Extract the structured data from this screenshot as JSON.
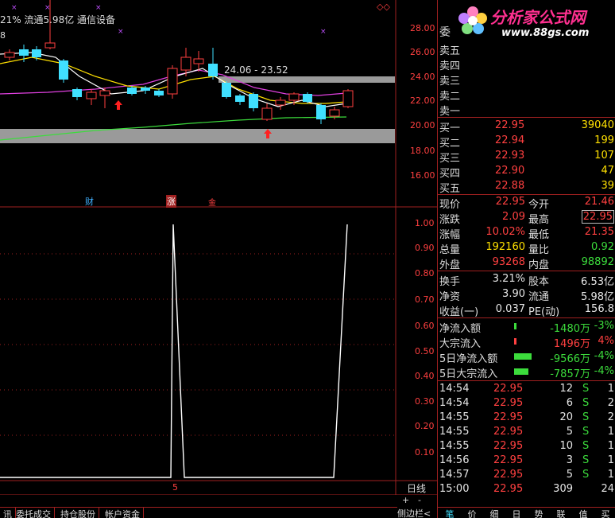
{
  "header": {
    "info_text": "21% 流通5.98亿 通信设备",
    "left_num": "8"
  },
  "logo": {
    "title": "分析家公式网",
    "url": "www.88gs.com"
  },
  "colors": {
    "up": "#ff4040",
    "down": "#40e0ff",
    "ma5": "#ffffff",
    "ma10": "#ffe000",
    "ma20": "#e040e0",
    "ma60": "#3cdc3c",
    "grid": "#a02020"
  },
  "kline": {
    "y_ticks": [
      "28.00",
      "26.00",
      "24.00",
      "22.00",
      "20.00",
      "18.00",
      "16.00"
    ],
    "range_label": "24.06 - 23.52",
    "markers": [
      "财",
      "涨",
      "金"
    ]
  },
  "indicator": {
    "y_ticks": [
      "1.00",
      "0.90",
      "0.80",
      "0.70",
      "0.60",
      "0.50",
      "0.40",
      "0.30",
      "0.20",
      "0.10"
    ],
    "bottom_label": "5",
    "period_label": "日线",
    "zoom_plus": "+",
    "zoom_minus": "-"
  },
  "chart_data": {
    "type": "line",
    "y_range": [
      0,
      1.05
    ],
    "points": [
      [
        0,
        0
      ],
      [
        215,
        0
      ],
      [
        218,
        1.0
      ],
      [
        232,
        0
      ],
      [
        420,
        0
      ],
      [
        437,
        1.0
      ]
    ]
  },
  "quote": {
    "wei": "委",
    "sell": [
      {
        "label": "卖五"
      },
      {
        "label": "卖四"
      },
      {
        "label": "卖三"
      },
      {
        "label": "卖二"
      },
      {
        "label": "卖一"
      }
    ],
    "buy": [
      {
        "label": "买一",
        "price": "22.95",
        "vol": "39040"
      },
      {
        "label": "买二",
        "price": "22.94",
        "vol": "199"
      },
      {
        "label": "买三",
        "price": "22.93",
        "vol": "107"
      },
      {
        "label": "买四",
        "price": "22.90",
        "vol": "47"
      },
      {
        "label": "买五",
        "price": "22.88",
        "vol": "39"
      }
    ],
    "stats1": [
      {
        "l1": "现价",
        "v1": "22.95",
        "l2": "今开",
        "v2": "21.46"
      },
      {
        "l1": "涨跌",
        "v1": "2.09",
        "l2": "最高",
        "v2": "22.95"
      },
      {
        "l1": "涨幅",
        "v1": "10.02%",
        "l2": "最低",
        "v2": "21.35"
      },
      {
        "l1": "总量",
        "v1": "192160",
        "l2": "量比",
        "v2": "0.92"
      },
      {
        "l1": "外盘",
        "v1": "93268",
        "l2": "内盘",
        "v2": "98892"
      }
    ],
    "stats2": [
      {
        "l1": "换手",
        "v1": "3.21%",
        "l2": "股本",
        "v2": "6.53亿"
      },
      {
        "l1": "净资",
        "v1": "3.90",
        "l2": "流通",
        "v2": "5.98亿"
      },
      {
        "l1": "收益(一)",
        "v1": "0.037",
        "l2": "PE(动)",
        "v2": "156.8"
      }
    ],
    "flows": [
      {
        "label": "净流入额",
        "value": "-1480万",
        "pct": "-3%"
      },
      {
        "label": "大宗流入",
        "value": "1496万",
        "pct": "4%"
      },
      {
        "label": "5日净流入额",
        "value": "-9566万",
        "pct": "-4%"
      },
      {
        "label": "5日大宗流入",
        "value": "-7857万",
        "pct": "-4%"
      }
    ],
    "ticks": [
      {
        "time": "14:54",
        "price": "22.95",
        "vol": "12",
        "side": "S",
        "n": "1"
      },
      {
        "time": "14:54",
        "price": "22.95",
        "vol": "6",
        "side": "S",
        "n": "2"
      },
      {
        "time": "14:55",
        "price": "22.95",
        "vol": "20",
        "side": "S",
        "n": "2"
      },
      {
        "time": "14:55",
        "price": "22.95",
        "vol": "5",
        "side": "S",
        "n": "1"
      },
      {
        "time": "14:55",
        "price": "22.95",
        "vol": "10",
        "side": "S",
        "n": "1"
      },
      {
        "time": "14:56",
        "price": "22.95",
        "vol": "3",
        "side": "S",
        "n": "1"
      },
      {
        "time": "14:57",
        "price": "22.95",
        "vol": "5",
        "side": "S",
        "n": "1"
      },
      {
        "time": "15:00",
        "price": "22.95",
        "vol": "309",
        "side": "",
        "n": "24"
      }
    ]
  },
  "bottom_tabs": [
    "讯",
    "委托成交",
    "持仓股份",
    "帐户资金"
  ],
  "side_toggle": "侧边栏<",
  "right_tabs": [
    "笔",
    "价",
    "细",
    "日",
    "势",
    "联",
    "值",
    "买"
  ]
}
